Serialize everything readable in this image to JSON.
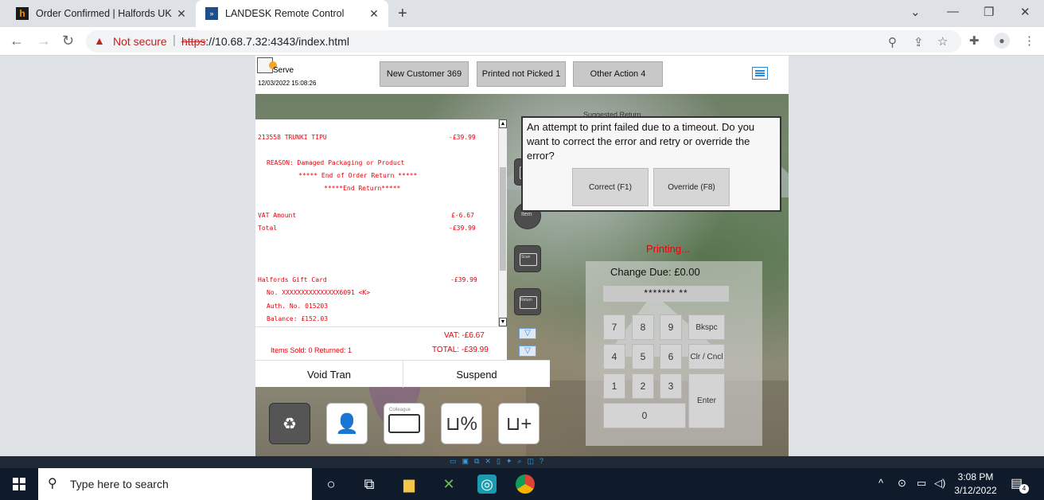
{
  "browser": {
    "tabs": [
      {
        "title": "Order Confirmed | Halfords UK",
        "favicon": "halfords-h-icon"
      },
      {
        "title": "LANDESK Remote Control",
        "favicon": "landesk-icon"
      }
    ],
    "security_label": "Not secure",
    "url_scheme": "https",
    "url_rest": "://10.68.7.32:4343/index.html"
  },
  "pos": {
    "header": {
      "serve_label": "Serve",
      "datetime": "12/03/2022 15:08:26",
      "buttons": [
        "New Customer 369",
        "Printed not Picked 1",
        "Other Action 4"
      ]
    },
    "receipt_lines": [
      "213558 TRUNKI TIPU",
      "-£39.99",
      "REASON: Damaged Packaging or Product",
      "***** End of Order Return *****",
      "*****End Return*****",
      "VAT Amount",
      "£-6.67",
      "Total",
      "-£39.99",
      "Halfords Gift Card",
      "-£39.99",
      "No. XXXXXXXXXXXXXXX6091 <K>",
      "Auth. No. 015203",
      "Balance: £152.03"
    ],
    "totals": {
      "vat": "VAT:  -£6.67",
      "items": "Items Sold: 0  Returned: 1",
      "total": "TOTAL:  -£39.99"
    },
    "actions": [
      "Void Tran",
      "Suspend"
    ],
    "suggested_return": "Suggested Return",
    "side_icon_labels": [
      "Item",
      "Scan",
      "Return"
    ],
    "bottom_icon_labels": [
      "Colleague"
    ],
    "dialog": {
      "message": "An attempt to print failed due to a timeout. Do you want to correct the error and retry or override the error?",
      "buttons": [
        "Correct (F1)",
        "Override (F8)"
      ]
    },
    "printing": "Printing...",
    "change_due": "Change Due: £0.00",
    "pin_mask": "******* **",
    "keypad": [
      "7",
      "8",
      "9",
      "Bkspc",
      "4",
      "5",
      "6",
      "Clr / Cncl",
      "1",
      "2",
      "3",
      "Enter",
      "0"
    ]
  },
  "taskbar": {
    "search_placeholder": "Type here to search",
    "time": "3:08 PM",
    "date": "3/12/2022",
    "notification_count": "4"
  }
}
